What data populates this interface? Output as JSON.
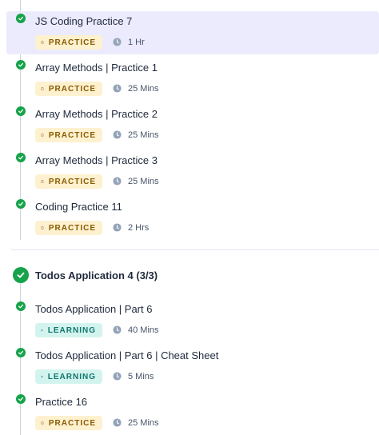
{
  "items_top": [
    {
      "title": "JS Coding Practice 7",
      "badge": "PRACTICE",
      "duration": "1 Hr",
      "active": true
    },
    {
      "title": "Array Methods | Practice 1",
      "badge": "PRACTICE",
      "duration": "25 Mins"
    },
    {
      "title": "Array Methods | Practice 2",
      "badge": "PRACTICE",
      "duration": "25 Mins"
    },
    {
      "title": "Array Methods | Practice 3",
      "badge": "PRACTICE",
      "duration": "25 Mins"
    },
    {
      "title": "Coding Practice 11",
      "badge": "PRACTICE",
      "duration": "2 Hrs"
    }
  ],
  "group": {
    "title": "Todos Application 4 (3/3)",
    "items": [
      {
        "title": "Todos Application | Part 6",
        "badge": "LEARNING",
        "duration": "40 Mins"
      },
      {
        "title": "Todos Application | Part 6 | Cheat Sheet",
        "badge": "LEARNING",
        "duration": "5 Mins"
      },
      {
        "title": "Practice 16",
        "badge": "PRACTICE",
        "duration": "25 Mins"
      }
    ]
  },
  "colors": {
    "check": "#16a34a",
    "active_bg": "#ecebfd",
    "practice_bg": "#fdf1cf",
    "practice_text": "#8a5a00",
    "learning_bg": "#d3f4ee",
    "learning_text": "#0f766e"
  },
  "icons": {
    "check": "check-icon",
    "practice": "clipboard-icon",
    "learning": "book-open-icon",
    "time": "clock-icon"
  }
}
